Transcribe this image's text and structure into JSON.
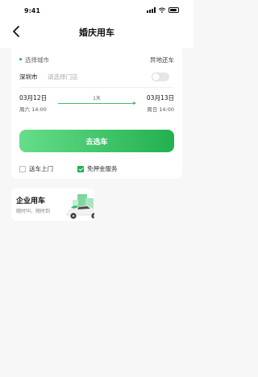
{
  "status_bar": {
    "time": "9:41"
  },
  "nav": {
    "title": "婚庆用车"
  },
  "location": {
    "select_city": "选择城市",
    "different_return": "异地还车",
    "city": "深圳市",
    "store_placeholder": "请选择门店",
    "different_return_toggle": false
  },
  "dates": {
    "start_date": "03月12日",
    "start_sub": "周六 14:00",
    "duration": "1天",
    "end_date": "03月13日",
    "end_sub": "周日 14:00"
  },
  "cta_label": "去选车",
  "options": [
    {
      "label": "送车上门",
      "checked": false
    },
    {
      "label": "免押金服务",
      "checked": true
    }
  ],
  "enterprise": {
    "title": "企业用车",
    "subtitle": "随时叫，随时到"
  },
  "colors": {
    "accent": "#22b04f",
    "accent_light": "#66dd8a"
  },
  "icons": [
    "back-arrow-icon",
    "signal-icon",
    "wifi-icon",
    "battery-icon",
    "check-icon",
    "car-illustration-icon"
  ]
}
